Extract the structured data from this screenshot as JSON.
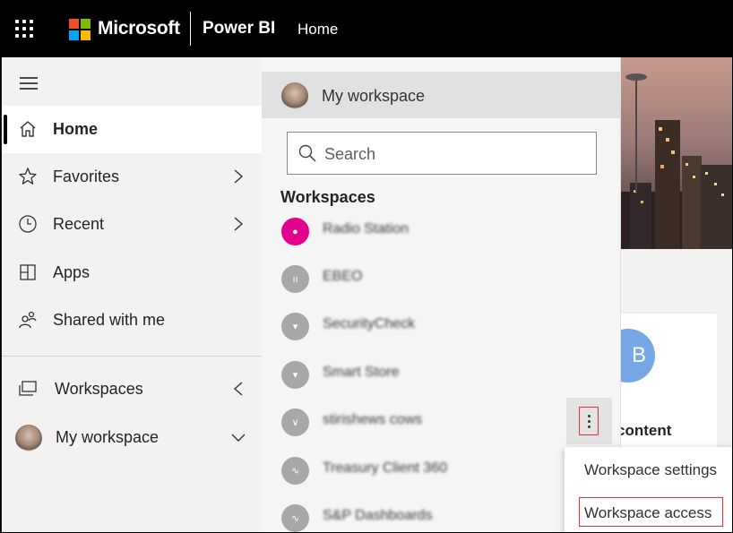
{
  "topbar": {
    "brand": "Microsoft",
    "product": "Power BI",
    "breadcrumb": "Home",
    "logo_colors": [
      "#f25022",
      "#7fba00",
      "#00a4ef",
      "#ffb900"
    ]
  },
  "leftnav": {
    "items": [
      {
        "label": "Home",
        "icon": "home-icon",
        "active": true
      },
      {
        "label": "Favorites",
        "icon": "star-icon",
        "chevron": "right"
      },
      {
        "label": "Recent",
        "icon": "clock-icon",
        "chevron": "right"
      },
      {
        "label": "Apps",
        "icon": "apps-icon"
      },
      {
        "label": "Shared with me",
        "icon": "shared-icon"
      },
      {
        "label": "Workspaces",
        "icon": "workspaces-icon",
        "chevron": "left"
      },
      {
        "label": "My workspace",
        "icon": "avatar",
        "chevron": "down"
      }
    ]
  },
  "flyout": {
    "my_workspace": "My workspace",
    "search_placeholder": "Search",
    "heading": "Workspaces",
    "workspaces": [
      {
        "name": "Radio Station",
        "icon_color": "#e3008c"
      },
      {
        "name": "EBEO",
        "icon_color": "#a8a8a8"
      },
      {
        "name": "SecurityCheck",
        "icon_color": "#a8a8a8"
      },
      {
        "name": "Smart Store",
        "icon_color": "#a8a8a8"
      },
      {
        "name": "stirishews cows",
        "icon_color": "#a8a8a8"
      },
      {
        "name": "Treasury Client 360",
        "icon_color": "#a8a8a8"
      },
      {
        "name": "S&P Dashboards",
        "icon_color": "#a8a8a8"
      }
    ]
  },
  "background": {
    "card_initial": "B",
    "card_text": "content"
  },
  "context_menu": {
    "items": [
      "Workspace settings",
      "Workspace access"
    ],
    "highlight_color": "#e0303a"
  }
}
